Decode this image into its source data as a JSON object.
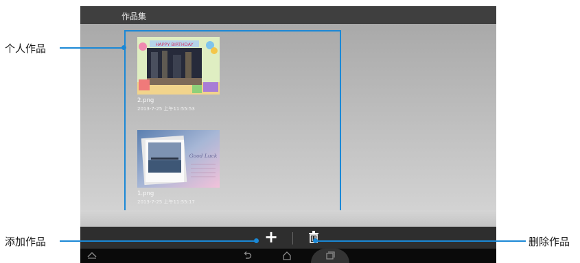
{
  "app": {
    "title": "作品集"
  },
  "gallery": {
    "items": [
      {
        "file_name": "2.png",
        "date": "2013-7-25 上午11:55:53",
        "card_text": "HAPPY BIRTHDAY"
      },
      {
        "file_name": "1.png",
        "date": "2013-7-25 上午11:55:17",
        "card_text": "Good Luck"
      }
    ]
  },
  "callouts": {
    "personal_works": "个人作品",
    "add_work": "添加作品",
    "delete_work": "删除作品"
  },
  "actionbar": {
    "add_icon": "plus-icon",
    "delete_icon": "trash-icon"
  },
  "navbar": {
    "icons": [
      "chevron-up-icon",
      "back-icon",
      "home-icon",
      "recent-apps-icon"
    ]
  },
  "colors": {
    "accent": "#1a88d6",
    "titlebar": "#3f3f3f",
    "actionbar": "#2e2e2e",
    "navbar": "#0a0a0a"
  }
}
